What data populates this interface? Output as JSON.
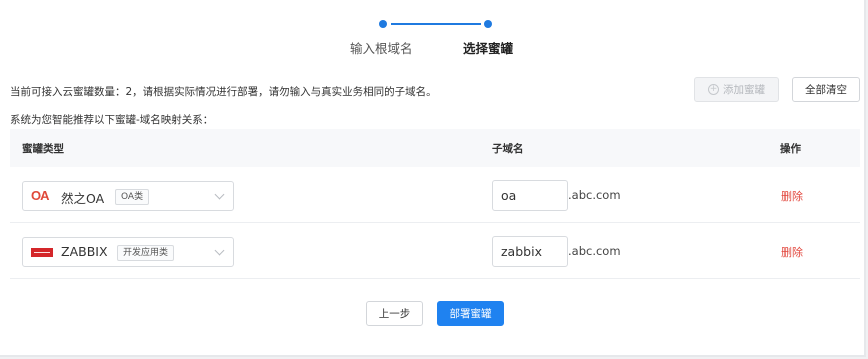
{
  "steps": {
    "step1": "输入根域名",
    "step2": "选择蜜罐"
  },
  "info": {
    "line1": "当前可接入云蜜罐数量：2，请根据实际情况进行部署，请勿输入与真实业务相同的子域名。",
    "line2": "系统为您智能推荐以下蜜罐-域名映射关系："
  },
  "toolbar": {
    "add_label": "添加蜜罐",
    "add_icon": "plus-circle-icon",
    "clear_label": "全部清空"
  },
  "table": {
    "headers": {
      "type": "蜜罐类型",
      "subdomain": "子域名",
      "action": "操作"
    },
    "rows": [
      {
        "logo": "oa-logo",
        "logo_text": "OA",
        "name": "然之OA",
        "tag": "OA类",
        "subdomain": "oa",
        "suffix": ".abc.com",
        "action": "删除"
      },
      {
        "logo": "zabbix-logo",
        "name": "ZABBIX",
        "tag": "开发应用类",
        "subdomain": "zabbix",
        "suffix": ".abc.com",
        "action": "删除"
      }
    ]
  },
  "footer": {
    "prev_label": "上一步",
    "deploy_label": "部署蜜罐"
  },
  "colors": {
    "primary": "#1f82f0",
    "danger": "#e2463c"
  }
}
